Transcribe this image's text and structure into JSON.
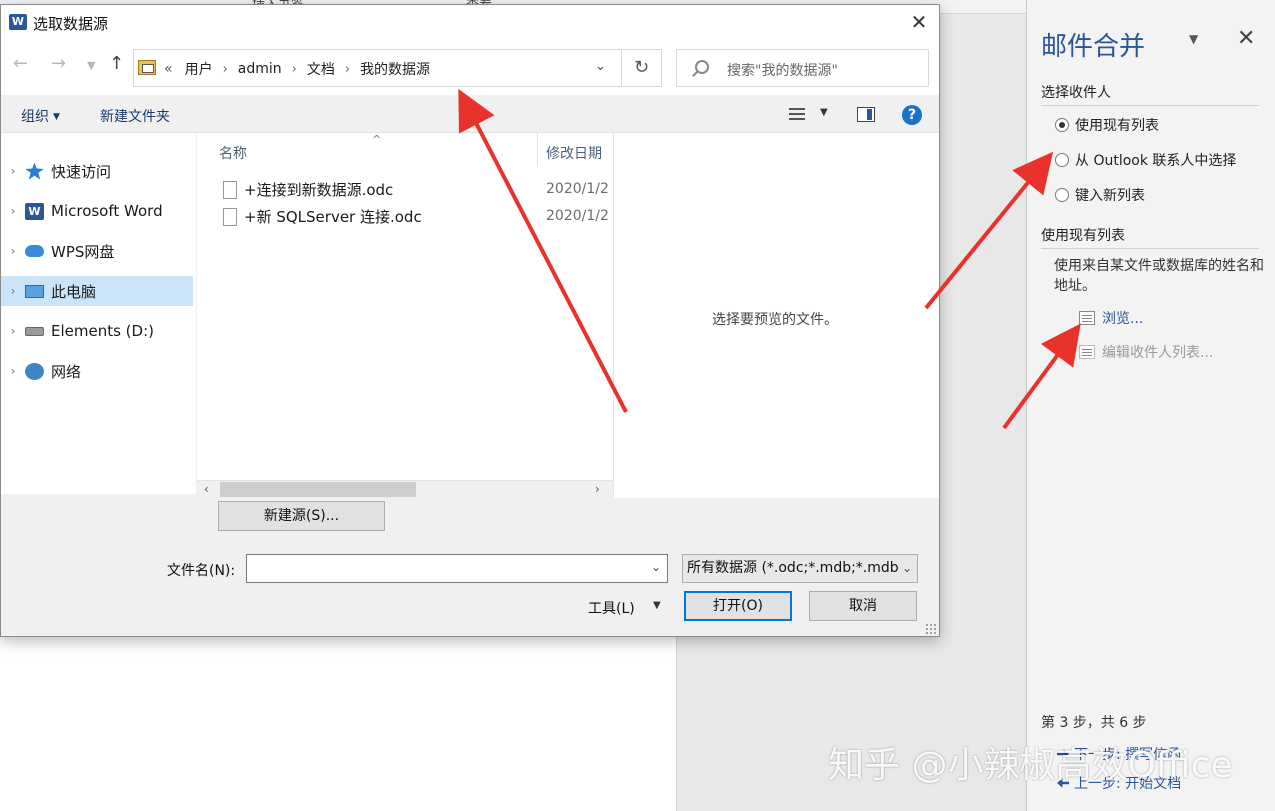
{
  "background": {
    "ribbon_tabs": [
      "插入书签",
      "查看"
    ]
  },
  "pane": {
    "title": "邮件合并",
    "section_select": "选择收件人",
    "radio_options": [
      {
        "label": "使用现有列表",
        "selected": true
      },
      {
        "label": "从 Outlook 联系人中选择",
        "selected": false
      },
      {
        "label": "键入新列表",
        "selected": false
      }
    ],
    "section_existing": "使用现有列表",
    "description": "使用来自某文件或数据库的姓名和地址。",
    "browse_link": "浏览...",
    "edit_link": "编辑收件人列表...",
    "step_info": "第 3 步，共 6 步",
    "next_step": "下一步: 撰写信函",
    "prev_step": "上一步: 开始文档"
  },
  "dialog": {
    "title": "选取数据源",
    "breadcrumb_lead": "«",
    "breadcrumb": [
      "用户",
      "admin",
      "文档",
      "我的数据源"
    ],
    "search_placeholder": "搜索\"我的数据源\"",
    "organize": "组织",
    "new_folder": "新建文件夹",
    "help": "?",
    "nav_items": [
      {
        "label": "快速访问",
        "icon": "quick-access-star-icon"
      },
      {
        "label": "Microsoft Word",
        "icon": "word-app-icon"
      },
      {
        "label": "WPS网盘",
        "icon": "cloud-drive-icon"
      },
      {
        "label": "此电脑",
        "icon": "this-pc-icon"
      },
      {
        "label": "Elements (D:)",
        "icon": "drive-icon"
      },
      {
        "label": "网络",
        "icon": "network-icon"
      }
    ],
    "columns": {
      "name": "名称",
      "modified": "修改日期"
    },
    "files": [
      {
        "name": "+连接到新数据源.odc",
        "date": "2020/1/2"
      },
      {
        "name": "+新 SQLServer 连接.odc",
        "date": "2020/1/2"
      }
    ],
    "preview_text": "选择要预览的文件。",
    "new_source_button": "新建源(S)...",
    "filename_label": "文件名(N):",
    "filename_value": "",
    "filetype": "所有数据源 (*.odc;*.mdb;*.mdb",
    "tools_label": "工具(L)",
    "open_button": "打开(O)",
    "cancel_button": "取消"
  },
  "watermark": "知乎 @小辣椒高效Office",
  "colors": {
    "accent": "#2b5797",
    "arrow": "#e8322b",
    "selection": "#cce4f7"
  }
}
